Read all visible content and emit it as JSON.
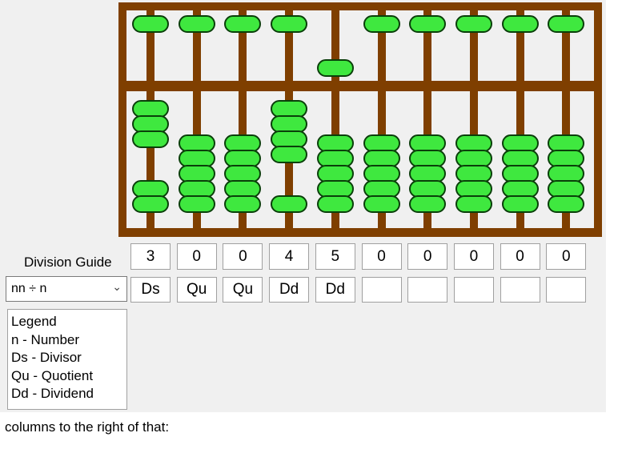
{
  "guide": {
    "label": "Division Guide"
  },
  "digits": [
    "3",
    "0",
    "0",
    "4",
    "5",
    "0",
    "0",
    "0",
    "0",
    "0"
  ],
  "roles": [
    "Ds",
    "Qu",
    "Qu",
    "Dd",
    "Dd",
    "",
    "",
    "",
    "",
    ""
  ],
  "mode": {
    "selected": "nn ÷ n"
  },
  "legend": {
    "title": "Legend",
    "items": [
      "n - Number",
      "Ds - Divisor",
      "Qu - Quotient",
      "Dd - Dividend"
    ]
  },
  "caption": "columns to the right of that:",
  "colors": {
    "bead": "#3fe83f",
    "frame": "#7f3f00",
    "panel": "#f0f0f0"
  }
}
